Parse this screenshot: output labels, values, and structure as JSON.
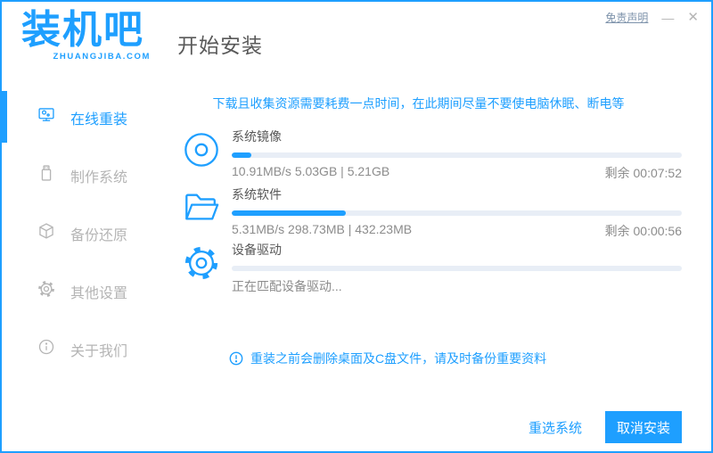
{
  "colors": {
    "accent": "#1e9fff",
    "track": "#e8eef6",
    "text_dark": "#595959",
    "text_gray": "#8c8c8c",
    "sidebar_inactive": "#b5b5b5"
  },
  "titlebar": {
    "disclaimer": "免责声明",
    "minimize": "—",
    "close": "✕"
  },
  "logo": {
    "text": "装机吧",
    "domain": "ZHUANGJIBA.COM"
  },
  "header": {
    "title": "开始安装"
  },
  "sidebar": {
    "items": [
      {
        "label": "在线重装",
        "icon": "monitor-reinstall-icon",
        "active": true
      },
      {
        "label": "制作系统",
        "icon": "usb-drive-icon",
        "active": false
      },
      {
        "label": "备份还原",
        "icon": "backup-restore-icon",
        "active": false
      },
      {
        "label": "其他设置",
        "icon": "settings-gear-icon",
        "active": false
      },
      {
        "label": "关于我们",
        "icon": "info-icon",
        "active": false
      }
    ]
  },
  "main": {
    "notice": "下载且收集资源需要耗费一点时间，在此期间尽量不要使电脑休眠、断电等",
    "tasks": [
      {
        "name": "系统镜像",
        "icon": "disc-icon",
        "progress_percent": 4.4,
        "stats": "10.91MB/s 5.03GB | 5.21GB",
        "remaining": "剩余 00:07:52"
      },
      {
        "name": "系统软件",
        "icon": "folder-icon",
        "progress_percent": 25.3,
        "stats": "5.31MB/s 298.73MB | 432.23MB",
        "remaining": "剩余 00:00:56"
      },
      {
        "name": "设备驱动",
        "icon": "gear-icon",
        "progress_percent": 0,
        "stats": "正在匹配设备驱动...",
        "remaining": ""
      }
    ],
    "note": "重装之前会删除桌面及C盘文件，请及时备份重要资料"
  },
  "footer": {
    "reselect": "重选系统",
    "cancel": "取消安装"
  }
}
